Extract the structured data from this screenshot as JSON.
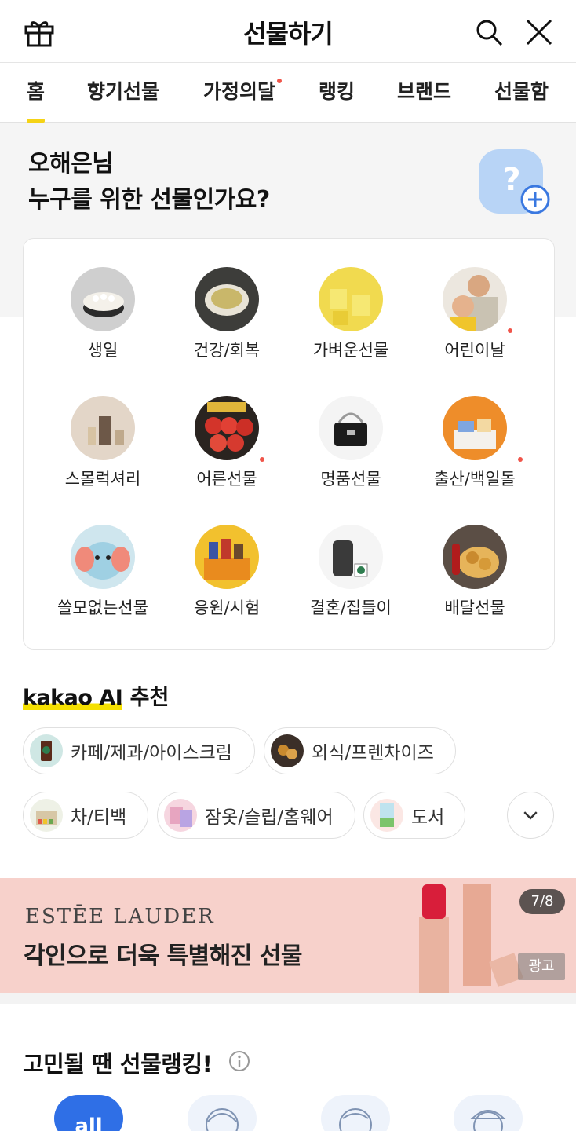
{
  "header": {
    "title": "선물하기"
  },
  "tabs": [
    {
      "label": "홈",
      "active": true,
      "dot": false
    },
    {
      "label": "향기선물",
      "active": false,
      "dot": false
    },
    {
      "label": "가정의달",
      "active": false,
      "dot": true
    },
    {
      "label": "랭킹",
      "active": false,
      "dot": false
    },
    {
      "label": "브랜드",
      "active": false,
      "dot": false
    },
    {
      "label": "선물함",
      "active": false,
      "dot": false
    }
  ],
  "greeting": {
    "line1": "오해은님",
    "line2": "누구를 위한 선물인가요?"
  },
  "categories": [
    {
      "label": "생일",
      "dot": false
    },
    {
      "label": "건강/회복",
      "dot": false
    },
    {
      "label": "가벼운선물",
      "dot": false
    },
    {
      "label": "어린이날",
      "dot": true
    },
    {
      "label": "스몰럭셔리",
      "dot": false
    },
    {
      "label": "어른선물",
      "dot": true
    },
    {
      "label": "명품선물",
      "dot": false
    },
    {
      "label": "출산/백일돌",
      "dot": true
    },
    {
      "label": "쓸모없는선물",
      "dot": false
    },
    {
      "label": "응원/시험",
      "dot": false
    },
    {
      "label": "결혼/집들이",
      "dot": false
    },
    {
      "label": "배달선물",
      "dot": false
    }
  ],
  "ai": {
    "brand": "kakao AI",
    "suffix": " 추천",
    "chips": [
      {
        "label": "카페/제과/아이스크림"
      },
      {
        "label": "외식/프렌차이즈"
      },
      {
        "label": "차/티백"
      },
      {
        "label": "잠옷/슬립/홈웨어"
      },
      {
        "label": "도서"
      }
    ]
  },
  "banner": {
    "brand": "ESTĒE LAUDER",
    "copy": "각인으로 더욱 특별해진 선물",
    "pager": "7/8",
    "ad_label": "광고"
  },
  "ranking": {
    "title": "고민될 땐 선물랭킹!",
    "all_label": "all"
  },
  "colors": {
    "accent_yellow": "#f5d316",
    "new_dot": "#f0554a",
    "banner_bg": "#f7d1cb",
    "rank_blue": "#2f6fe6"
  }
}
